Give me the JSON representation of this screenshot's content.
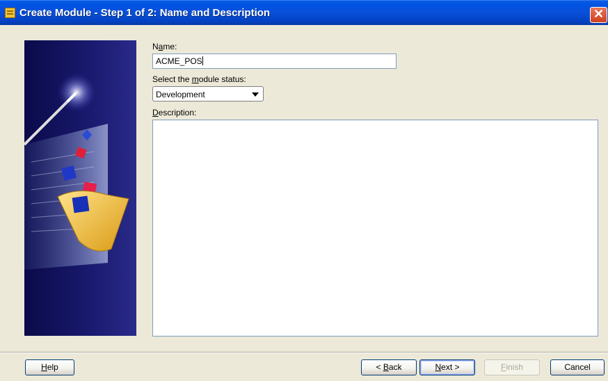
{
  "window": {
    "title": "Create Module - Step 1 of 2: Name and Description",
    "close_glyph": "✕",
    "icon": "module-wizard-icon"
  },
  "form": {
    "name_label_prefix": "N",
    "name_label_mnemonic": "a",
    "name_label_suffix": "me:",
    "name_value": "ACME_POS",
    "status_label_prefix": "Select the ",
    "status_label_mnemonic": "m",
    "status_label_suffix": "odule status:",
    "status_value": "Development",
    "description_label_mnemonic": "D",
    "description_label_suffix": "escription:",
    "description_value": ""
  },
  "buttons": {
    "help_mnemonic": "H",
    "help_rest": "elp",
    "back_prefix": "< ",
    "back_mnemonic": "B",
    "back_rest": "ack",
    "next_mnemonic": "N",
    "next_rest": "ext >",
    "finish_mnemonic": "F",
    "finish_rest": "inish",
    "cancel_label": "Cancel"
  },
  "colors": {
    "titlebar": "#0054e3",
    "dialog_bg": "#ece9d8",
    "wizard_panel_bg": "#1a1a70"
  }
}
